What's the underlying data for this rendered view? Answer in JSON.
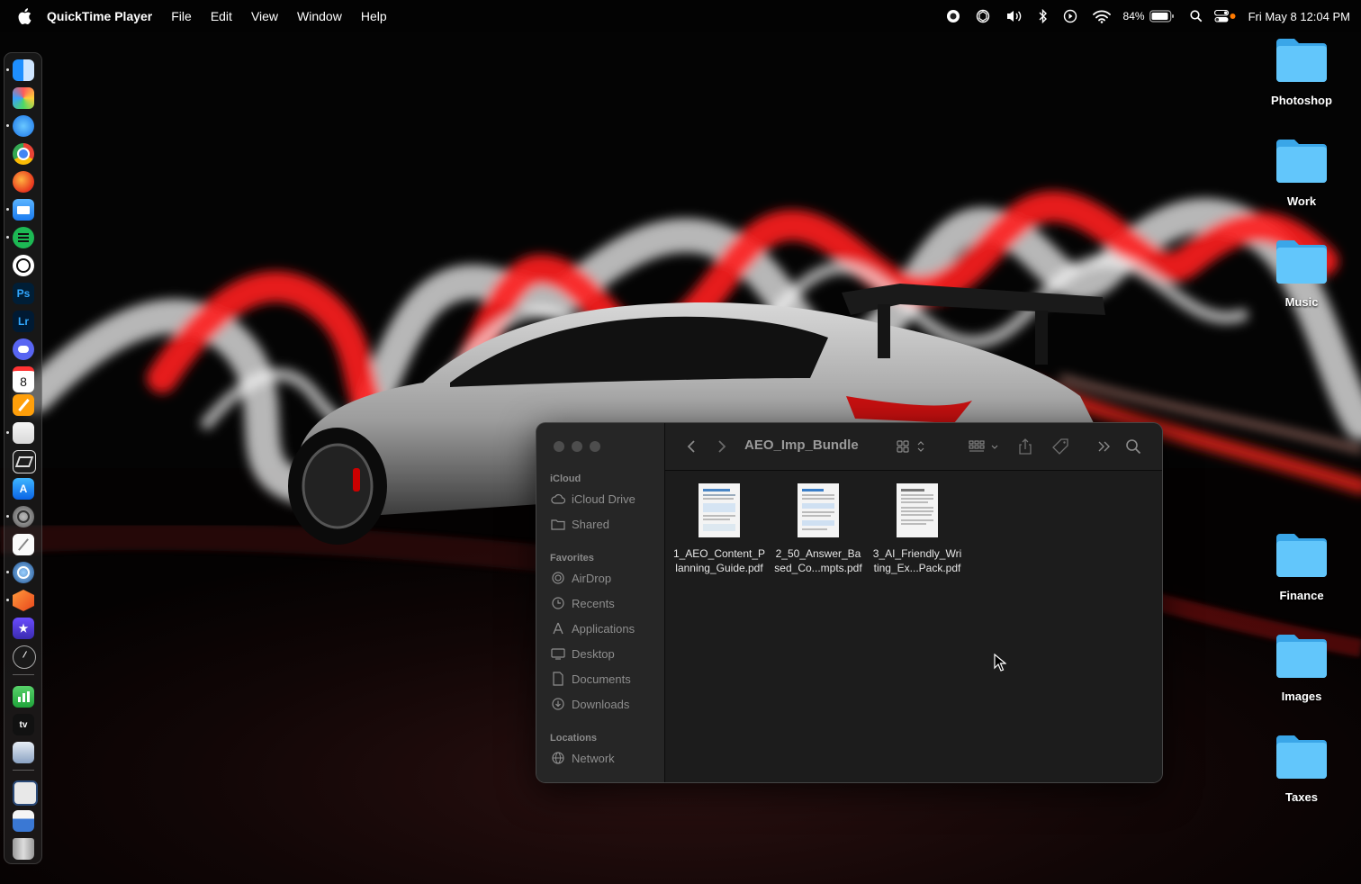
{
  "menubar": {
    "app_name": "QuickTime Player",
    "menus": [
      "File",
      "Edit",
      "View",
      "Window",
      "Help"
    ],
    "battery_percent": "84%",
    "datetime": "Fri May 8  12:04 PM",
    "status_icons": [
      "screen-record-icon",
      "chatgpt-icon",
      "volume-icon",
      "bluetooth-icon",
      "play-icon",
      "wifi-icon",
      "battery-icon",
      "spotlight-search-icon",
      "control-center-icon"
    ]
  },
  "dock": {
    "apps": [
      {
        "name": "finder",
        "label": ""
      },
      {
        "name": "launchpad",
        "label": ""
      },
      {
        "name": "safari",
        "label": ""
      },
      {
        "name": "chrome",
        "label": ""
      },
      {
        "name": "firefox",
        "label": ""
      },
      {
        "name": "mail",
        "label": ""
      },
      {
        "name": "spotify",
        "label": ""
      },
      {
        "name": "chatgpt",
        "label": ""
      },
      {
        "name": "photoshop",
        "label": "Ps"
      },
      {
        "name": "lightroom",
        "label": "Lr"
      },
      {
        "name": "discord",
        "label": ""
      },
      {
        "name": "calendar",
        "label": "8"
      },
      {
        "name": "pages",
        "label": ""
      },
      {
        "name": "files",
        "label": ""
      },
      {
        "name": "sketchup",
        "label": ""
      },
      {
        "name": "app-store",
        "label": ""
      },
      {
        "name": "system-settings",
        "label": ""
      },
      {
        "name": "textedit",
        "label": ""
      },
      {
        "name": "quicktime",
        "label": ""
      },
      {
        "name": "affinity",
        "label": ""
      },
      {
        "name": "imovie",
        "label": ""
      },
      {
        "name": "clock",
        "label": ""
      },
      {
        "name": "numbers",
        "label": ""
      },
      {
        "name": "apple-tv",
        "label": "tv"
      },
      {
        "name": "downloads-stack",
        "label": ""
      },
      {
        "name": "documents-stack",
        "label": ""
      },
      {
        "name": "screenshots-stack",
        "label": ""
      },
      {
        "name": "trash",
        "label": ""
      }
    ]
  },
  "desktop": {
    "folders": [
      "Photoshop",
      "Work",
      "Music",
      "Finance",
      "Images",
      "Taxes"
    ]
  },
  "finder": {
    "title": "AEO_Imp_Bundle",
    "sidebar": {
      "icloud_header": "iCloud",
      "icloud_items": [
        "iCloud Drive",
        "Shared"
      ],
      "favorites_header": "Favorites",
      "favorites_items": [
        "AirDrop",
        "Recents",
        "Applications",
        "Desktop",
        "Documents",
        "Downloads"
      ],
      "locations_header": "Locations",
      "locations_items": [
        "Network"
      ]
    },
    "files": [
      {
        "line1": "1_AEO_Content_P",
        "line2": "lanning_Guide.pdf"
      },
      {
        "line1": "2_50_Answer_Ba",
        "line2": "sed_Co...mpts.pdf"
      },
      {
        "line1": "3_AI_Friendly_Wri",
        "line2": "ting_Ex...Pack.pdf"
      }
    ]
  },
  "colors": {
    "folder_blue": "#5ac8fa",
    "light_red": "#e8141c",
    "sidebar_bg": "#262626",
    "window_bg": "#1c1c1c"
  }
}
